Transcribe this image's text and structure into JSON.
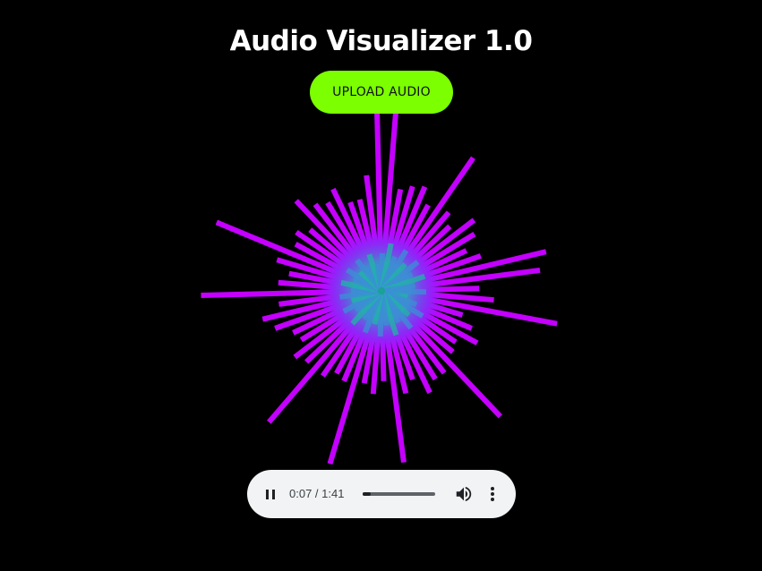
{
  "app": {
    "title": "Audio Visualizer 1.0",
    "upload_label": "UPLOAD AUDIO"
  },
  "player": {
    "current_time": "0:07",
    "separator": " / ",
    "duration": "1:41",
    "progress_fraction": 0.115,
    "play_state": "playing",
    "pause-icon": "pause-icon",
    "volume-icon": "volume-icon",
    "more-icon": "more-vert-icon"
  },
  "visualizer": {
    "type": "radial-frequency-bars",
    "colors": {
      "outer": "#c400ff",
      "mid": "#7b2cff",
      "inner": "#1fb5a6"
    },
    "bar_levels": [
      0.96,
      0.55,
      0.58,
      0.6,
      0.52,
      0.86,
      0.55,
      0.5,
      0.62,
      0.58,
      0.5,
      0.56,
      0.9,
      0.85,
      0.52,
      0.6,
      0.95,
      0.45,
      0.52,
      0.58,
      0.48,
      0.5,
      0.92,
      0.55,
      0.55,
      0.6,
      0.5,
      0.56,
      0.92,
      0.48,
      0.55,
      0.5,
      0.96,
      0.52,
      0.5,
      0.55,
      0.92,
      0.55,
      0.58,
      0.5,
      0.52,
      0.6,
      0.65,
      0.55,
      0.96,
      0.55,
      0.5,
      0.58,
      0.95,
      0.52,
      0.55,
      0.5,
      0.66,
      0.58,
      0.55,
      0.6,
      0.5,
      0.5,
      0.62,
      0.95
    ]
  },
  "colors": {
    "background": "#000000",
    "accent": "#7cff00",
    "title": "#ffffff",
    "player_bg": "#f1f3f4"
  }
}
